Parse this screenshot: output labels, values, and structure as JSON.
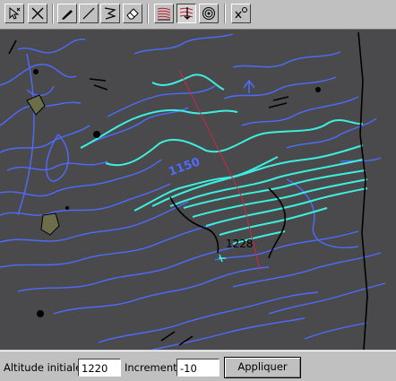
{
  "toolbar": {
    "tools": [
      {
        "name": "select-tool-icon"
      },
      {
        "name": "delete-tool-icon"
      },
      {
        "name": "pen-tool-icon"
      },
      {
        "name": "line-tool-icon"
      },
      {
        "name": "polyline-tool-icon"
      },
      {
        "name": "eraser-tool-icon"
      },
      {
        "name": "contour-lines-tool-icon"
      },
      {
        "name": "altitude-tool-icon"
      },
      {
        "name": "target-tool-icon"
      },
      {
        "name": "zoom-factor-tool-icon"
      }
    ],
    "pressed_tool": "altitude-tool-icon"
  },
  "map": {
    "altitude_labels": [
      "1150",
      "1228"
    ],
    "colors": {
      "background": "#4a4a4c",
      "contour": "#4d6cff",
      "selected_contour": "#3cf0e0",
      "profile_line": "#c8284a",
      "ridge": "#000000"
    }
  },
  "form": {
    "altitude_label": "Altitude initiale",
    "altitude_value": "1220",
    "increment_label": "Increment",
    "increment_value": "-10",
    "apply_button": "Appliquer"
  }
}
